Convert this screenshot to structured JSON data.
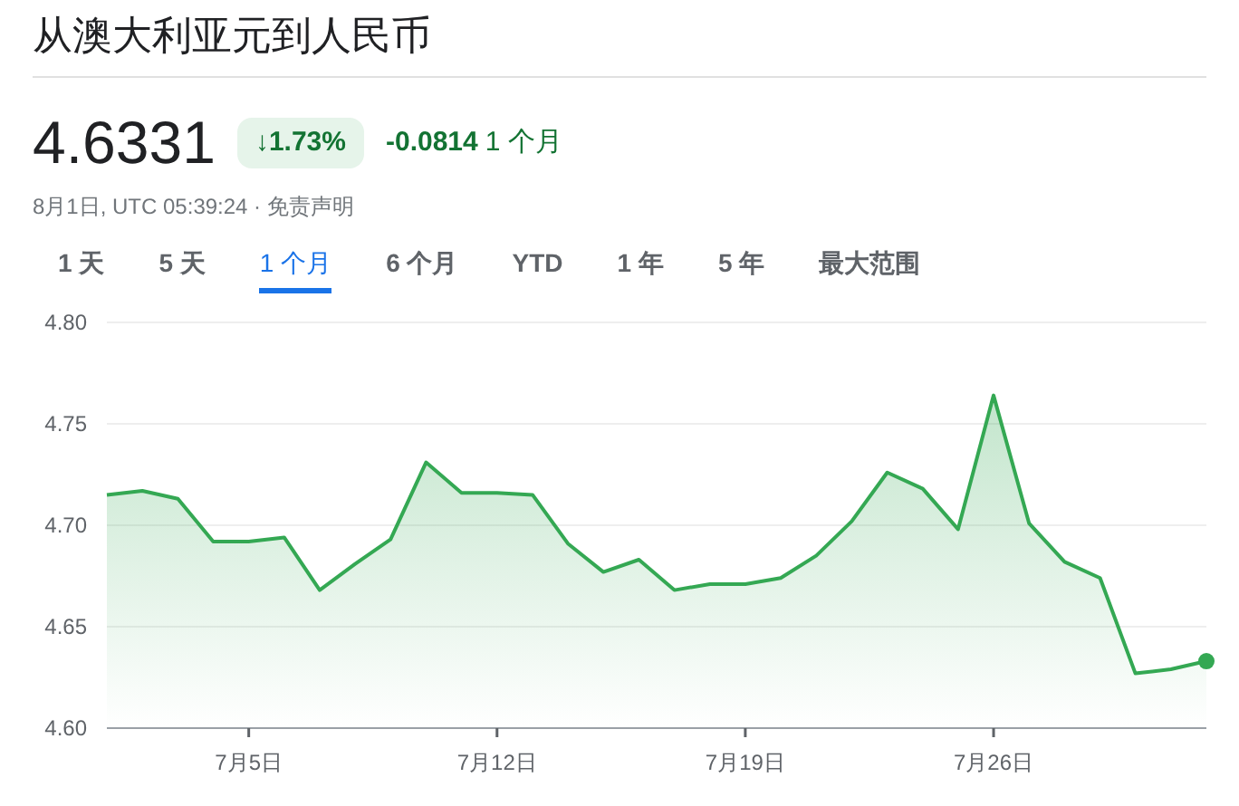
{
  "title": "从澳大利亚元到人民币",
  "quote": {
    "price": "4.6331",
    "change_badge": "↓1.73%",
    "change": "-0.0814",
    "period": "1 个月",
    "timestamp": "8月1日, UTC 05:39:24 · ",
    "disclaimer": "免责声明"
  },
  "tabs": [
    {
      "label": "1 天",
      "selected": false
    },
    {
      "label": "5 天",
      "selected": false
    },
    {
      "label": "1 个月",
      "selected": true
    },
    {
      "label": "6 个月",
      "selected": false
    },
    {
      "label": "YTD",
      "selected": false
    },
    {
      "label": "1 年",
      "selected": false
    },
    {
      "label": "5 年",
      "selected": false
    },
    {
      "label": "最大范围",
      "selected": false
    }
  ],
  "chart_data": {
    "type": "area",
    "categories": [
      null,
      null,
      null,
      null,
      "7月5日",
      null,
      null,
      null,
      null,
      null,
      null,
      "7月12日",
      null,
      null,
      null,
      null,
      null,
      null,
      "7月19日",
      null,
      null,
      null,
      null,
      null,
      null,
      "7月26日",
      null,
      null,
      null,
      null,
      null,
      null
    ],
    "series": [
      {
        "color": "#34a853",
        "values": [
          4.715,
          4.717,
          4.713,
          4.692,
          4.692,
          4.694,
          4.668,
          4.681,
          4.693,
          4.731,
          4.716,
          4.716,
          4.715,
          4.691,
          4.677,
          4.683,
          4.668,
          4.671,
          4.671,
          4.674,
          4.685,
          4.702,
          4.726,
          4.718,
          4.698,
          4.764,
          4.701,
          4.682,
          4.674,
          4.627,
          4.629,
          4.633
        ]
      }
    ],
    "ylim": [
      4.6,
      4.8
    ],
    "grid": true,
    "yticks": [
      {
        "value": 4.6,
        "label": "4.60"
      },
      {
        "value": 4.65,
        "label": "4.65"
      },
      {
        "value": 4.7,
        "label": "4.70"
      },
      {
        "value": 4.75,
        "label": "4.75"
      },
      {
        "value": 4.8,
        "label": "4.80"
      }
    ]
  }
}
